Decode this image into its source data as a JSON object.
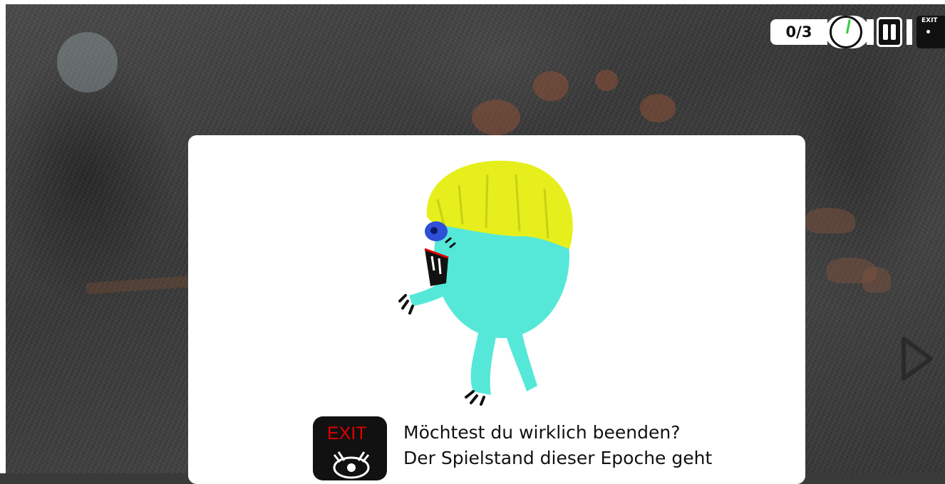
{
  "hud": {
    "score": "0/3",
    "timer_progress": 0.03,
    "exit_label": "EXIT"
  },
  "dialog": {
    "icon_label": "EXIT",
    "message_line1": "Möchtest du wirklich beenden?",
    "message_line2": "Der Spielstand dieser Epoche geht"
  },
  "colors": {
    "monster_body": "#55e8d8",
    "monster_hair": "#e6ef1c",
    "exit_red": "#e00000",
    "timer_green": "#2ecc40"
  }
}
